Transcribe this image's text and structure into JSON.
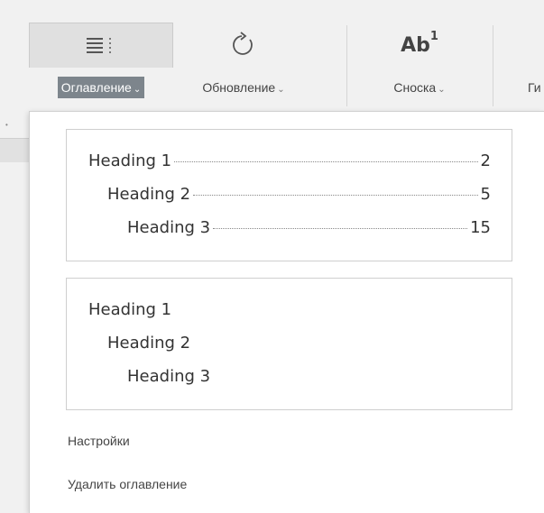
{
  "toolbar": {
    "toc": {
      "label": "Оглавление",
      "icon": "table-of-contents-icon"
    },
    "update": {
      "label": "Обновление",
      "icon": "refresh-icon"
    },
    "footnote": {
      "label": "Сноска",
      "icon": "footnote-icon",
      "glyph_main": "Ab",
      "glyph_sup": "1"
    },
    "cutoff": {
      "label": "Ги"
    }
  },
  "toc_menu": {
    "style_with_pages": {
      "rows": [
        {
          "text": "Heading 1",
          "page": "2"
        },
        {
          "text": "Heading 2",
          "page": "5"
        },
        {
          "text": "Heading 3",
          "page": "15"
        }
      ]
    },
    "style_plain": {
      "rows": [
        {
          "text": "Heading 1"
        },
        {
          "text": "Heading 2"
        },
        {
          "text": "Heading 3"
        }
      ]
    },
    "settings_label": "Настройки",
    "remove_label": "Удалить оглавление"
  },
  "colors": {
    "active_label_bg": "#7d858c",
    "panel_bg": "#ffffff",
    "toolbar_bg": "#f1f1f1"
  }
}
